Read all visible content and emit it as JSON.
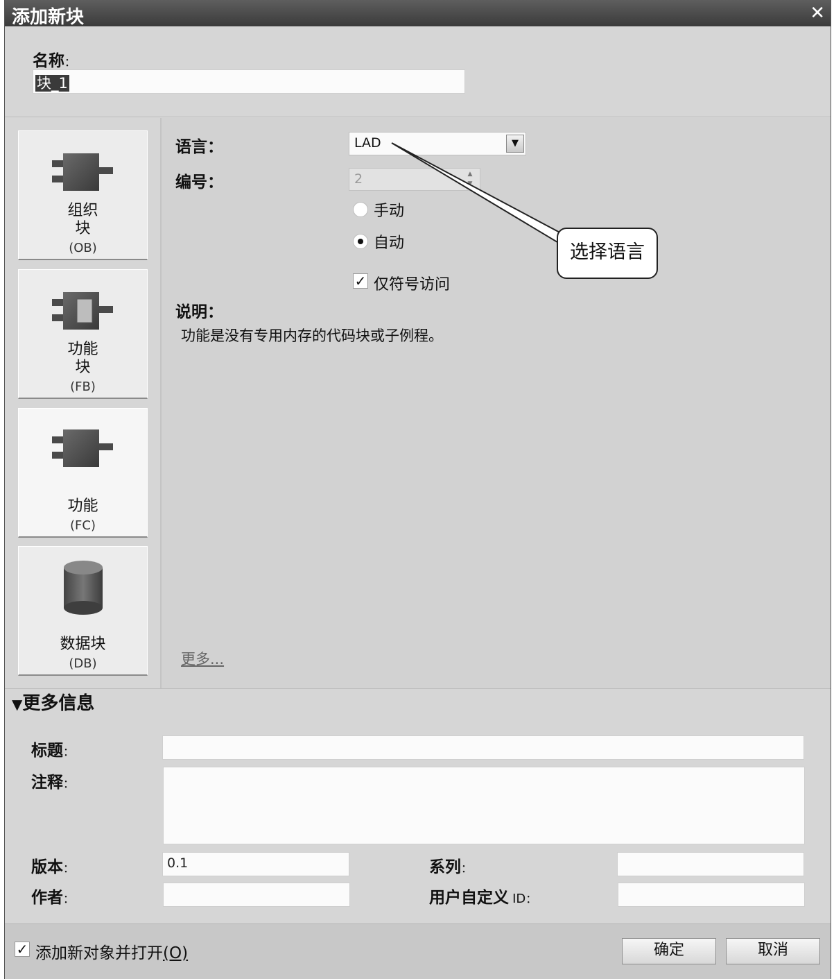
{
  "dialog": {
    "title": "添加新块",
    "close_glyph": "✕"
  },
  "name": {
    "label": "名称",
    "colon": "：",
    "value": "块_1"
  },
  "block_types": [
    {
      "line1": "组织",
      "line2": "块",
      "code": "(OB)",
      "icon": "ob-block-icon"
    },
    {
      "line1": "功能",
      "line2": "块",
      "code": "(FB)",
      "icon": "fb-block-icon"
    },
    {
      "line1": "功能",
      "line2": "",
      "code": "(FC)",
      "icon": "fc-block-icon",
      "selected": true
    },
    {
      "line1": "数据块",
      "line2": "",
      "code": "(DB)",
      "icon": "db-cylinder-icon"
    }
  ],
  "settings": {
    "language_label": "语言：",
    "language_value": "LAD",
    "number_label": "编号：",
    "number_value": "2",
    "radio_manual": "手动",
    "radio_auto": "自动",
    "symbolic_access": "仅符号访问",
    "description_label": "说明：",
    "description_text": "功能是没有专用内存的代码块或子例程。",
    "more_link": "更多..."
  },
  "callout": {
    "text": "选择语言"
  },
  "more_info": {
    "header": "更多信息",
    "title_label": "标题",
    "comment_label": "注释",
    "version_label": "版本",
    "version_value": "0.1",
    "family_label": "系列",
    "author_label": "作者",
    "user_id_label": "用户自定义",
    "user_id_suffix": "ID",
    "colon": "："
  },
  "footer": {
    "add_and_open": "添加新对象并打开",
    "add_and_open_key": "(O)",
    "ok": "确定",
    "cancel": "取消"
  }
}
